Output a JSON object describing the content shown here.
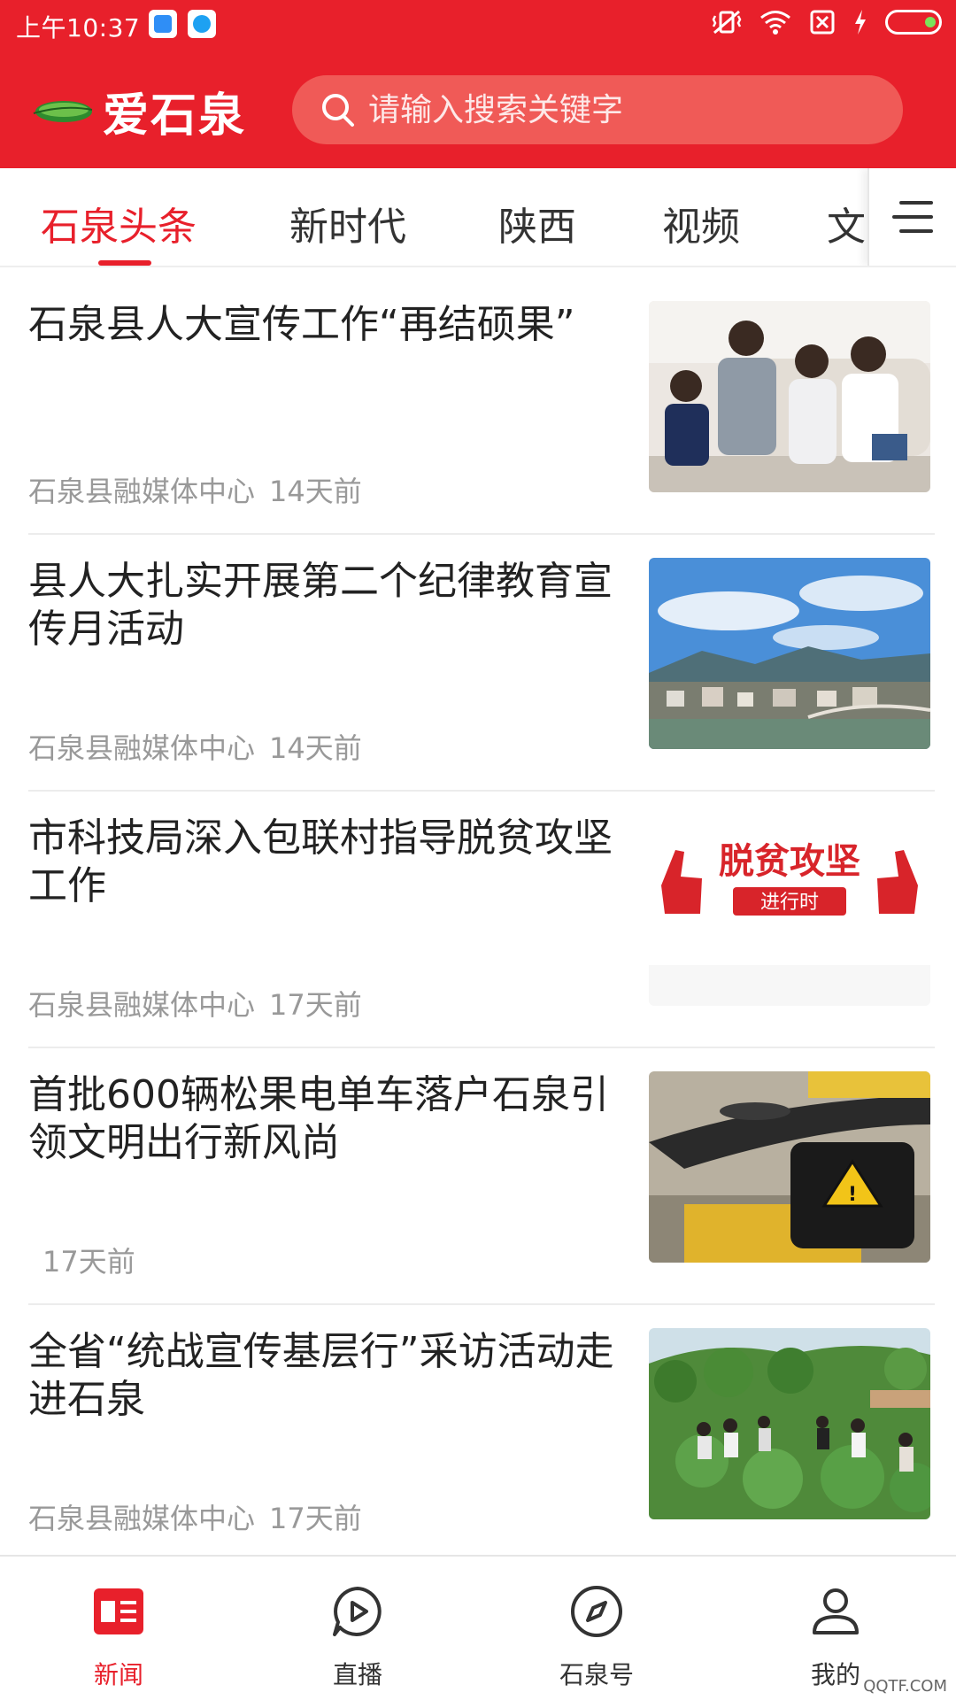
{
  "status_bar": {
    "time": "上午10:37"
  },
  "header": {
    "logo_text": "爱石泉",
    "search_placeholder": "请输入搜索关键字",
    "brand_color": "#e8202b"
  },
  "tabs": [
    {
      "label": "石泉头条",
      "active": true
    },
    {
      "label": "新时代",
      "active": false
    },
    {
      "label": "陕西",
      "active": false
    },
    {
      "label": "视频",
      "active": false
    },
    {
      "label": "文",
      "active": false
    }
  ],
  "news": [
    {
      "title": "石泉县人大宣传工作“再结硕果”",
      "source": "石泉县融媒体中心",
      "time": "14天前",
      "thumb": "family-photo"
    },
    {
      "title": "县人大扎实开展第二个纪律教育宣传月活动",
      "source": "石泉县融媒体中心",
      "time": "14天前",
      "thumb": "city-landscape"
    },
    {
      "title": "市科技局深入包联村指导脱贫攻坚工作",
      "source": "石泉县融媒体中心",
      "time": "17天前",
      "thumb": "poverty-alleviation-banner",
      "thumb_text": "脱贫攻坚",
      "thumb_subtext": "进行时"
    },
    {
      "title": "首批600辆松果电单车落户石泉引领文明出行新风尚",
      "source": "",
      "time": "17天前",
      "thumb": "electric-bike"
    },
    {
      "title": "全省“统战宣传基层行”采访活动走进石泉",
      "source": "石泉县融媒体中心",
      "time": "17天前",
      "thumb": "field-visit"
    }
  ],
  "bottom_nav": [
    {
      "label": "新闻",
      "icon": "news-icon",
      "active": true
    },
    {
      "label": "直播",
      "icon": "live-play-icon",
      "active": false
    },
    {
      "label": "石泉号",
      "icon": "compass-icon",
      "active": false
    },
    {
      "label": "我的",
      "icon": "user-icon",
      "active": false
    }
  ],
  "watermark": "QQTF.COM"
}
